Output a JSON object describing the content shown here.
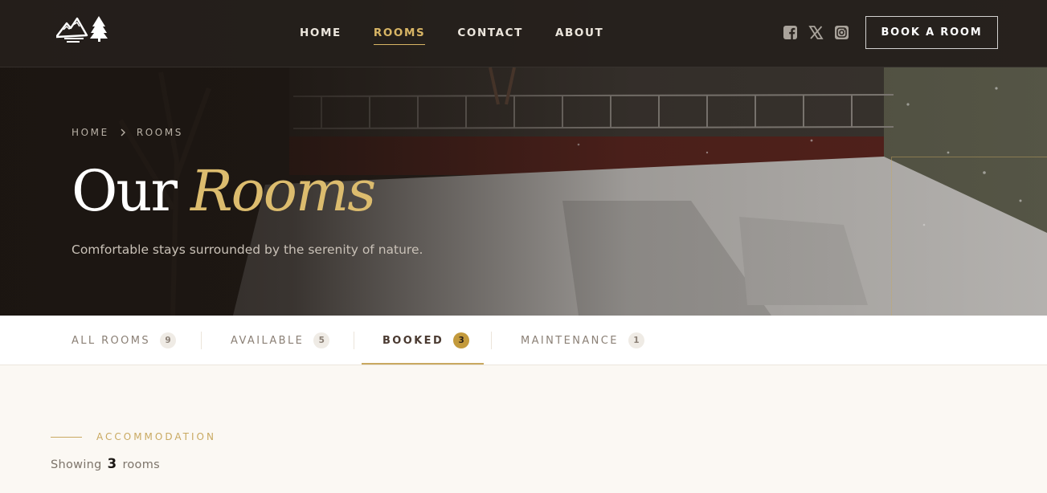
{
  "nav": {
    "links": [
      "HOME",
      "ROOMS",
      "CONTACT",
      "ABOUT"
    ],
    "active_link": "ROOMS",
    "social_icons": [
      "facebook-icon",
      "x-icon",
      "instagram-icon"
    ],
    "book_button": "BOOK A ROOM"
  },
  "hero": {
    "breadcrumb": [
      "HOME",
      "ROOMS"
    ],
    "title_main": "Our",
    "title_accent": "Rooms",
    "subtitle": "Comfortable stays surrounded by the serenity of nature."
  },
  "tabs": [
    {
      "label": "ALL ROOMS",
      "count": "9"
    },
    {
      "label": "AVAILABLE",
      "count": "5"
    },
    {
      "label": "BOOKED",
      "count": "3"
    },
    {
      "label": "MAINTENANCE",
      "count": "1"
    }
  ],
  "active_tab": "BOOKED",
  "content": {
    "section_label": "ACCOMMODATION",
    "showing_prefix": "Showing",
    "showing_count": "3",
    "showing_suffix": "rooms"
  },
  "colors": {
    "accent_gold": "#c9a961",
    "nav_active": "#d8b565",
    "hero_dark": "#2a241f",
    "page_bg": "#fbf8f3"
  }
}
